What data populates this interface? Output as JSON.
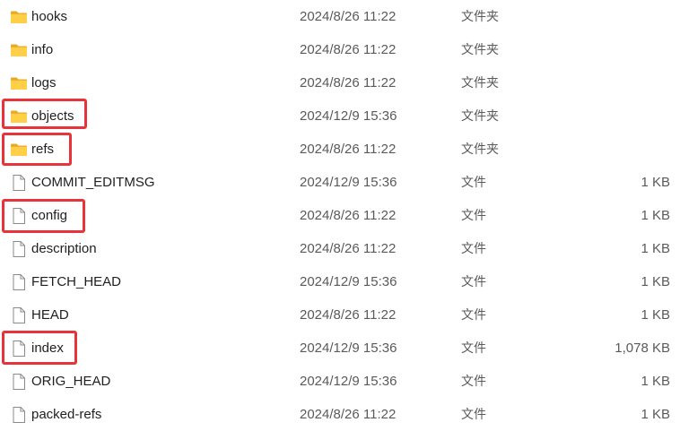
{
  "files": [
    {
      "name": "hooks",
      "date": "2024/8/26 11:22",
      "type": "文件夹",
      "size": "",
      "icon": "folder-icon"
    },
    {
      "name": "info",
      "date": "2024/8/26 11:22",
      "type": "文件夹",
      "size": "",
      "icon": "folder-icon"
    },
    {
      "name": "logs",
      "date": "2024/8/26 11:22",
      "type": "文件夹",
      "size": "",
      "icon": "folder-icon"
    },
    {
      "name": "objects",
      "date": "2024/12/9 15:36",
      "type": "文件夹",
      "size": "",
      "icon": "folder-icon"
    },
    {
      "name": "refs",
      "date": "2024/8/26 11:22",
      "type": "文件夹",
      "size": "",
      "icon": "folder-icon"
    },
    {
      "name": "COMMIT_EDITMSG",
      "date": "2024/12/9 15:36",
      "type": "文件",
      "size": "1 KB",
      "icon": "file-icon"
    },
    {
      "name": "config",
      "date": "2024/8/26 11:22",
      "type": "文件",
      "size": "1 KB",
      "icon": "file-icon"
    },
    {
      "name": "description",
      "date": "2024/8/26 11:22",
      "type": "文件",
      "size": "1 KB",
      "icon": "file-icon"
    },
    {
      "name": "FETCH_HEAD",
      "date": "2024/12/9 15:36",
      "type": "文件",
      "size": "1 KB",
      "icon": "file-icon"
    },
    {
      "name": "HEAD",
      "date": "2024/8/26 11:22",
      "type": "文件",
      "size": "1 KB",
      "icon": "file-icon"
    },
    {
      "name": "index",
      "date": "2024/12/9 15:36",
      "type": "文件",
      "size": "1,078 KB",
      "icon": "file-icon"
    },
    {
      "name": "ORIG_HEAD",
      "date": "2024/12/9 15:36",
      "type": "文件",
      "size": "1 KB",
      "icon": "file-icon"
    },
    {
      "name": "packed-refs",
      "date": "2024/8/26 11:22",
      "type": "文件",
      "size": "1 KB",
      "icon": "file-icon"
    }
  ],
  "highlight_color": "#e8333a",
  "folder_color": "#f4c430"
}
